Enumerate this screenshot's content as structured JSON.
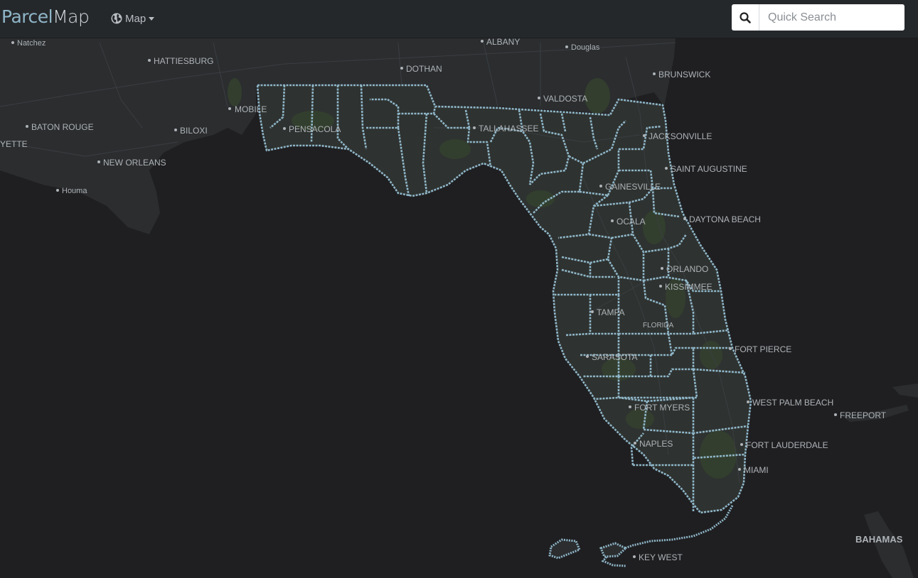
{
  "app": {
    "brand_part1": "Parcel",
    "brand_part2": "Map"
  },
  "nav": {
    "map_label": "Map",
    "map_icon": "globe-icon"
  },
  "search": {
    "icon": "search-icon",
    "placeholder": "Quick Search",
    "value": ""
  },
  "map": {
    "colors": {
      "water": "#1f1f21",
      "land": "#2b2d2f",
      "vegetation": "#34402f",
      "county_border": "#8fb6c8",
      "label": "#aeb3b7"
    },
    "labels": {
      "natchez": "Natchez",
      "hattiesburg": "HATTIESBURG",
      "albany": "ALBANY",
      "douglas": "Douglas",
      "dothan": "DOTHAN",
      "brunswick": "BRUNSWICK",
      "valdosta": "VALDOSTA",
      "mobile": "MOBILE",
      "baton_rouge": "BATON ROUGE",
      "biloxi": "BILOXI",
      "pensacola": "PENSACOLA",
      "tallahassee": "TALLAHASSEE",
      "jacksonville": "JACKSONVILLE",
      "yette": "YETTE",
      "new_orleans": "NEW ORLEANS",
      "saint_augustine": "SAINT AUGUSTINE",
      "houma": "Houma",
      "gainesville": "GAINESVILLE",
      "daytona_beach": "DAYTONA BEACH",
      "ocala": "OCALA",
      "orlando": "ORLANDO",
      "kissimmee": "KISSIMMEE",
      "tampa": "TAMPA",
      "florida": "FLORIDA",
      "fort_pierce": "FORT PIERCE",
      "sarasota": "SARASOTA",
      "west_palm_beach": "WEST PALM BEACH",
      "freeport": "FREEPORT",
      "fort_myers": "FORT MYERS",
      "naples": "NAPLES",
      "fort_lauderdale": "FORT LAUDERDALE",
      "miami": "MIAMI",
      "bahamas": "BAHAMAS",
      "key_west": "KEY WEST"
    }
  }
}
